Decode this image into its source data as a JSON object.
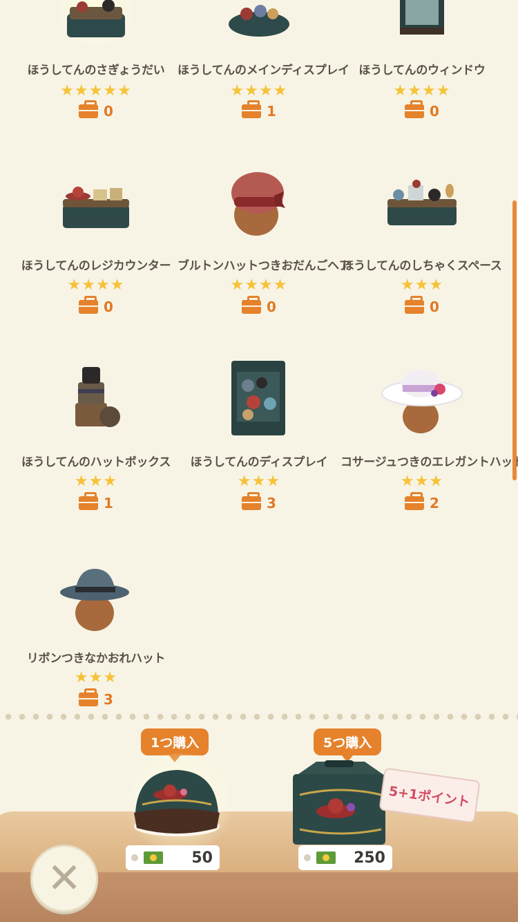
{
  "items": [
    {
      "name": "ほうしてんのさぎょうだい",
      "stars": "★★★★★",
      "owned": "0",
      "icon": "workbench-icon"
    },
    {
      "name": "ほうしてんのメインディスプレイ",
      "stars": "★★★★",
      "owned": "1",
      "icon": "main-display-icon"
    },
    {
      "name": "ほうしてんのウィンドウ",
      "stars": "★★★★",
      "owned": "0",
      "icon": "window-icon"
    },
    {
      "name": "ほうしてんのレジカウンター",
      "stars": "★★★★",
      "owned": "0",
      "icon": "register-counter-icon"
    },
    {
      "name": "ブルトンハットつきおだんごヘア",
      "stars": "★★★★",
      "owned": "0",
      "icon": "breton-hat-icon"
    },
    {
      "name": "ほうしてんのしちゃくスペース",
      "stars": "★★★",
      "owned": "0",
      "icon": "fitting-space-icon"
    },
    {
      "name": "ほうしてんのハットボックス",
      "stars": "★★★",
      "owned": "1",
      "icon": "hatbox-icon"
    },
    {
      "name": "ほうしてんのディスプレイ",
      "stars": "★★★",
      "owned": "3",
      "icon": "display-case-icon"
    },
    {
      "name": "コサージュつきのエレガントハット",
      "stars": "★★★",
      "owned": "2",
      "icon": "elegant-hat-icon"
    },
    {
      "name": "リボンつきなかおれハット",
      "stars": "★★★",
      "owned": "3",
      "icon": "fedora-icon"
    }
  ],
  "purchase": {
    "single": {
      "label": "1つ購入",
      "price": "50"
    },
    "multi": {
      "label": "5つ購入",
      "price": "250",
      "bonus": "5+1ポイント"
    }
  },
  "colors": {
    "accent": "#e5822b",
    "star": "#f6c237",
    "background": "#f7f4e6"
  }
}
